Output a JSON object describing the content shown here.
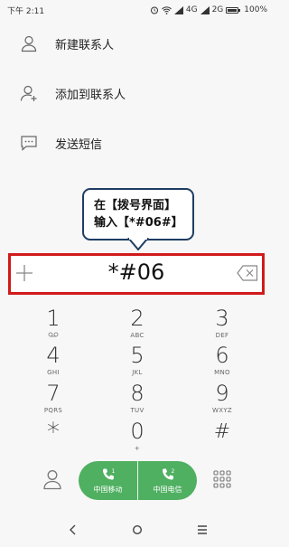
{
  "status_bar": {
    "time": "下午 2:11",
    "network_1": "4G",
    "network_2": "2G",
    "battery": "100%"
  },
  "menu": {
    "items": [
      {
        "label": "新建联系人",
        "icon": "person-icon"
      },
      {
        "label": "添加到联系人",
        "icon": "person-add-icon"
      },
      {
        "label": "发送短信",
        "icon": "message-icon"
      }
    ]
  },
  "callout": {
    "line1": "在【拨号界面】",
    "line2": "输入【*#06#】"
  },
  "dialer": {
    "number": "*#06",
    "keys": [
      {
        "digit": "1",
        "sub": "voicemail"
      },
      {
        "digit": "2",
        "sub": "ABC"
      },
      {
        "digit": "3",
        "sub": "DEF"
      },
      {
        "digit": "4",
        "sub": "GHI"
      },
      {
        "digit": "5",
        "sub": "JKL"
      },
      {
        "digit": "6",
        "sub": "MNO"
      },
      {
        "digit": "7",
        "sub": "PQRS"
      },
      {
        "digit": "8",
        "sub": "TUV"
      },
      {
        "digit": "9",
        "sub": "WXYZ"
      },
      {
        "digit": "*",
        "sub": ""
      },
      {
        "digit": "0",
        "sub": "+"
      },
      {
        "digit": "#",
        "sub": ""
      }
    ]
  },
  "call_buttons": [
    {
      "sim": "1",
      "label": "中国移动"
    },
    {
      "sim": "2",
      "label": "中国电信"
    }
  ],
  "colors": {
    "call_green": "#4fb061",
    "highlight_red": "#d11a1a",
    "callout_border": "#1f3d63"
  }
}
